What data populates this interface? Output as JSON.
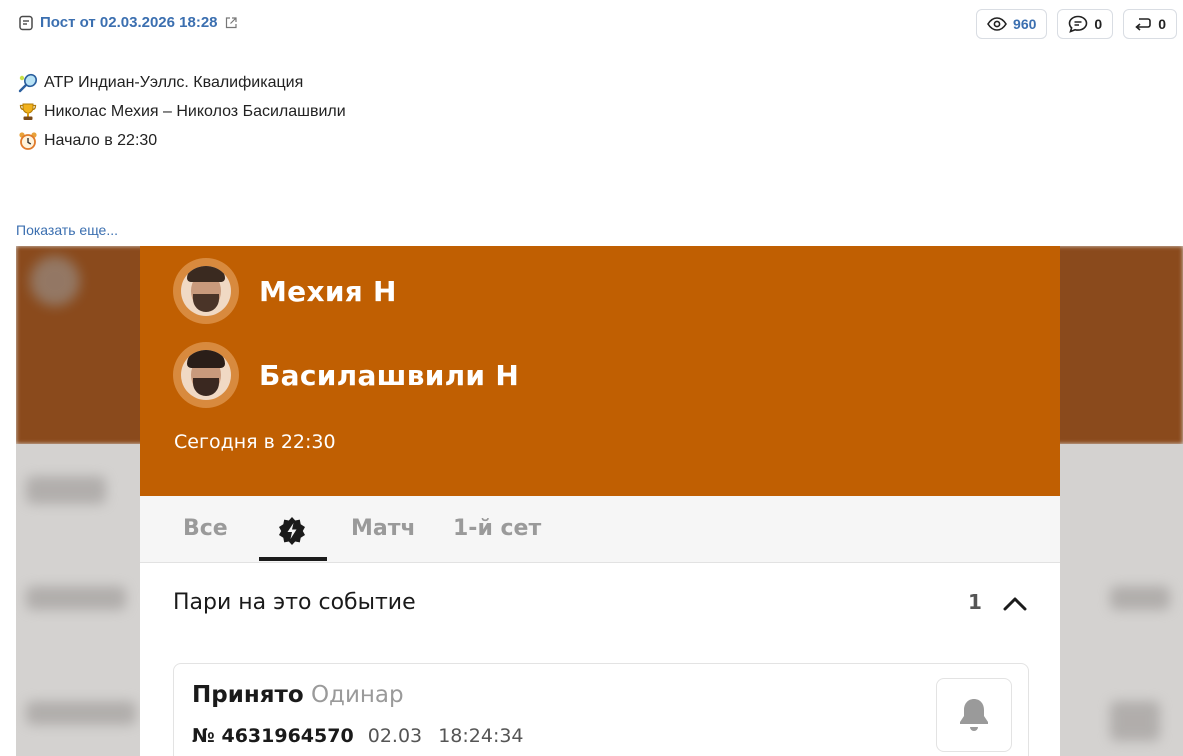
{
  "post": {
    "title": "Пост от 02.03.2026 18:28",
    "views": "960",
    "comments": "0",
    "reposts": "0"
  },
  "lines": [
    {
      "icon": "tennis-racket-icon",
      "text": "ATP Индиан-Уэллс. Квалификация"
    },
    {
      "icon": "trophy-icon",
      "text": "Николас Мехия – Николоз Басилашвили"
    },
    {
      "icon": "alarm-clock-icon",
      "text": "Начало в 22:30"
    }
  ],
  "show_more": "Показать еще...",
  "screenshot": {
    "players": [
      "Мехия Н",
      "Басилашвили Н"
    ],
    "when": "Сегодня в 22:30",
    "tabs": [
      "Все",
      "Матч",
      "1-й сет"
    ],
    "bets_title": "Пари на это событие",
    "bets_count": "1",
    "bet": {
      "status": "Принято",
      "type": "Одинар",
      "number": "№ 4631964570",
      "date": "02.03",
      "time": "18:24:34"
    }
  },
  "colors": {
    "accent": "#c05f02",
    "link": "#3b6fb0"
  }
}
